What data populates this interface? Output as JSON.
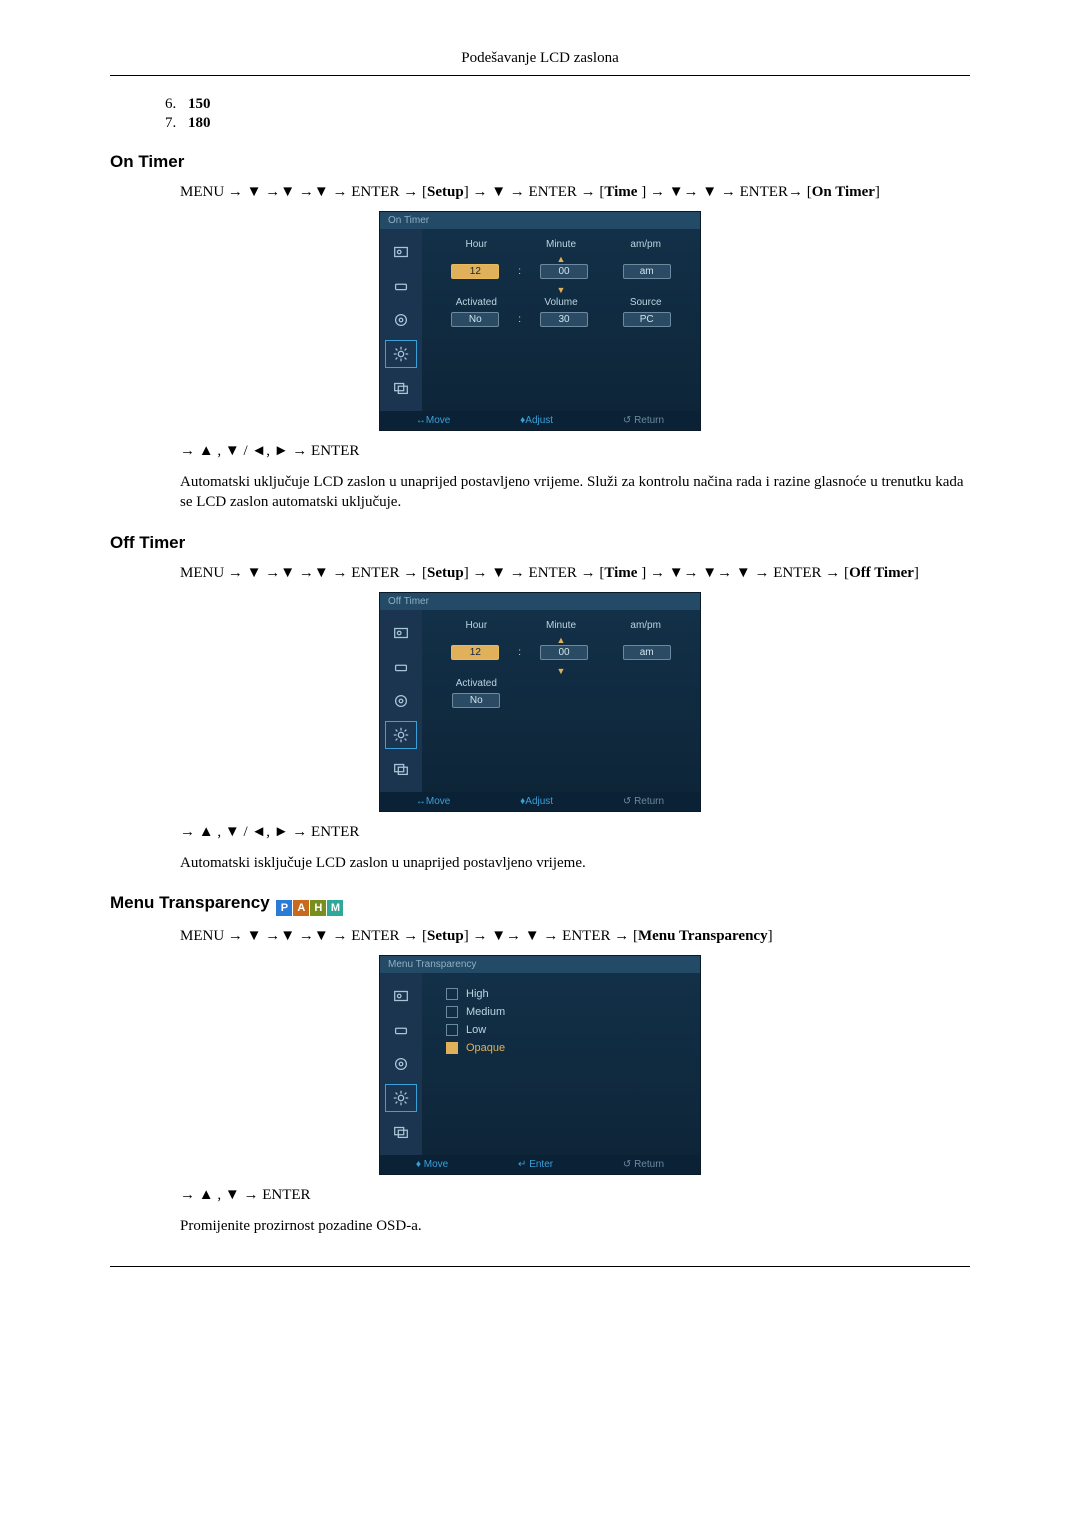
{
  "header": {
    "title": "Podešavanje LCD zaslona"
  },
  "numbered": {
    "start": 6,
    "items": [
      "150",
      "180"
    ]
  },
  "sections": {
    "onTimer": {
      "heading": "On Timer",
      "nav": {
        "pre": "MENU → ",
        "seq": "▼ →▼ →▼ → ENTER → [",
        "setup": "Setup",
        "mid1": "] → ▼ → ENTER → [",
        "time": "Time ",
        "mid2": "] → ▼→ ▼ → ENTER→ [",
        "target": "On Timer",
        "post": "]"
      },
      "nav2": "→ ▲ , ▼ / ◄, ► → ENTER",
      "desc": "Automatski uključuje LCD zaslon u unaprijed postavljeno vrijeme. Služi za kontrolu načina rada i razine glasnoće u trenutku kada se LCD zaslon automatski uključuje.",
      "osd": {
        "title": "On Timer",
        "cols1": [
          "Hour",
          "Minute",
          "am/pm"
        ],
        "hour": "12",
        "minute": "00",
        "ampm": "am",
        "cols2": [
          "Activated",
          "Volume",
          "Source"
        ],
        "activated": "No",
        "volume": "30",
        "source": "PC",
        "footer": {
          "move": "Move",
          "adjust": "Adjust",
          "ret": "Return"
        }
      }
    },
    "offTimer": {
      "heading": "Off Timer",
      "nav": {
        "pre": "MENU → ",
        "seq": "▼ →▼ →▼ → ENTER → [",
        "setup": "Setup",
        "mid1": "] → ▼ → ENTER → [",
        "time": "Time ",
        "mid2": "] → ▼→ ▼→ ▼ → ENTER → [",
        "target": "Off Timer",
        "post": "]"
      },
      "nav2": "→ ▲ , ▼ / ◄, ► → ENTER",
      "desc": "Automatski isključuje LCD zaslon u unaprijed postavljeno vrijeme.",
      "osd": {
        "title": "Off Timer",
        "cols1": [
          "Hour",
          "Minute",
          "am/pm"
        ],
        "hour": "12",
        "minute": "00",
        "ampm": "am",
        "cols2": [
          "Activated"
        ],
        "activated": "No",
        "footer": {
          "move": "Move",
          "adjust": "Adjust",
          "ret": "Return"
        }
      }
    },
    "menuTransparency": {
      "heading": "Menu Transparency",
      "badges": [
        "P",
        "A",
        "H",
        "M"
      ],
      "nav": {
        "pre": "MENU → ",
        "seq": "▼ →▼ →▼ → ENTER → [",
        "setup": "Setup",
        "mid1": "] → ▼→ ▼ → ENTER → [",
        "target": "Menu Transparency",
        "post": "]"
      },
      "nav2": "→ ▲ , ▼ → ENTER",
      "desc": "Promijenite prozirnost pozadine OSD-a.",
      "osd": {
        "title": "Menu Transparency",
        "items": [
          "High",
          "Medium",
          "Low",
          "Opaque"
        ],
        "selected": "Opaque",
        "footer": {
          "move": "Move",
          "enter": "Enter",
          "ret": "Return"
        }
      }
    }
  }
}
